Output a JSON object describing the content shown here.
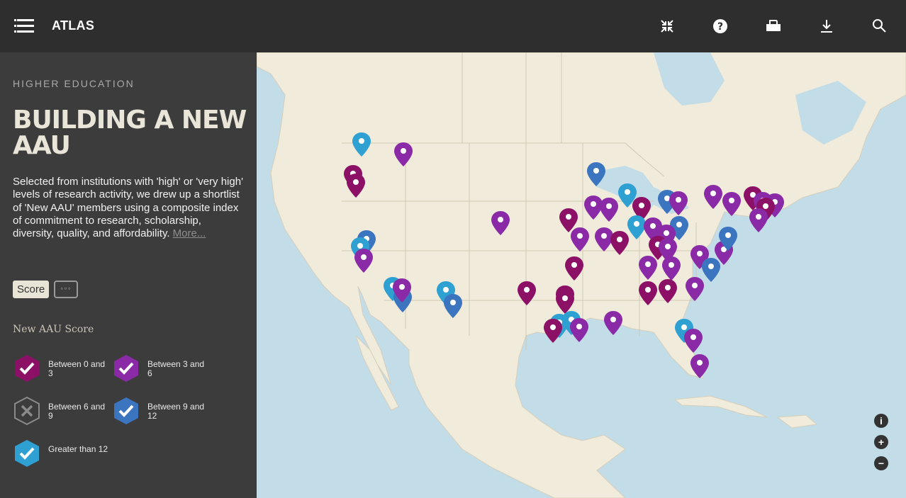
{
  "app": {
    "brand": "ATLAS"
  },
  "toolbar": {
    "icons": [
      "collapse-icon",
      "help-icon",
      "print-icon",
      "download-icon",
      "search-icon"
    ]
  },
  "sidebar": {
    "kicker": "HIGHER EDUCATION",
    "title": "BUILDING A NEW AAU",
    "description": "Selected from institutions with 'high' or 'very high' levels of research activity, we drew up a shortlist of 'New AAU' members using a composite index of commitment to research, scholarship, diversity, quality, and affordability.",
    "more_link": "More...",
    "score_button": "Score",
    "options_button": "◦◦◦"
  },
  "legend": {
    "title": "New AAU Score",
    "items": [
      {
        "label": "Between 0 and 3",
        "color": "#8c1065",
        "checked": true
      },
      {
        "label": "Between 3 and 6",
        "color": "#8a2aa6",
        "checked": true
      },
      {
        "label": "Between 6 and 9",
        "color": "#3c3c3c",
        "checked": false
      },
      {
        "label": "Between 9 and 12",
        "color": "#3b74bf",
        "checked": true
      },
      {
        "label": "Greater than 12",
        "color": "#2ea0d2",
        "checked": true
      }
    ]
  },
  "colors": {
    "score_0_3": "#8c1065",
    "score_3_6": "#8a2aa6",
    "score_9_12": "#3b74bf",
    "score_gt_12": "#2ea0d2",
    "water": "#c2dce8",
    "land": "#f0ebda"
  },
  "map_controls": {
    "info": "i",
    "zoom_in": "+",
    "zoom_out": "−"
  }
}
